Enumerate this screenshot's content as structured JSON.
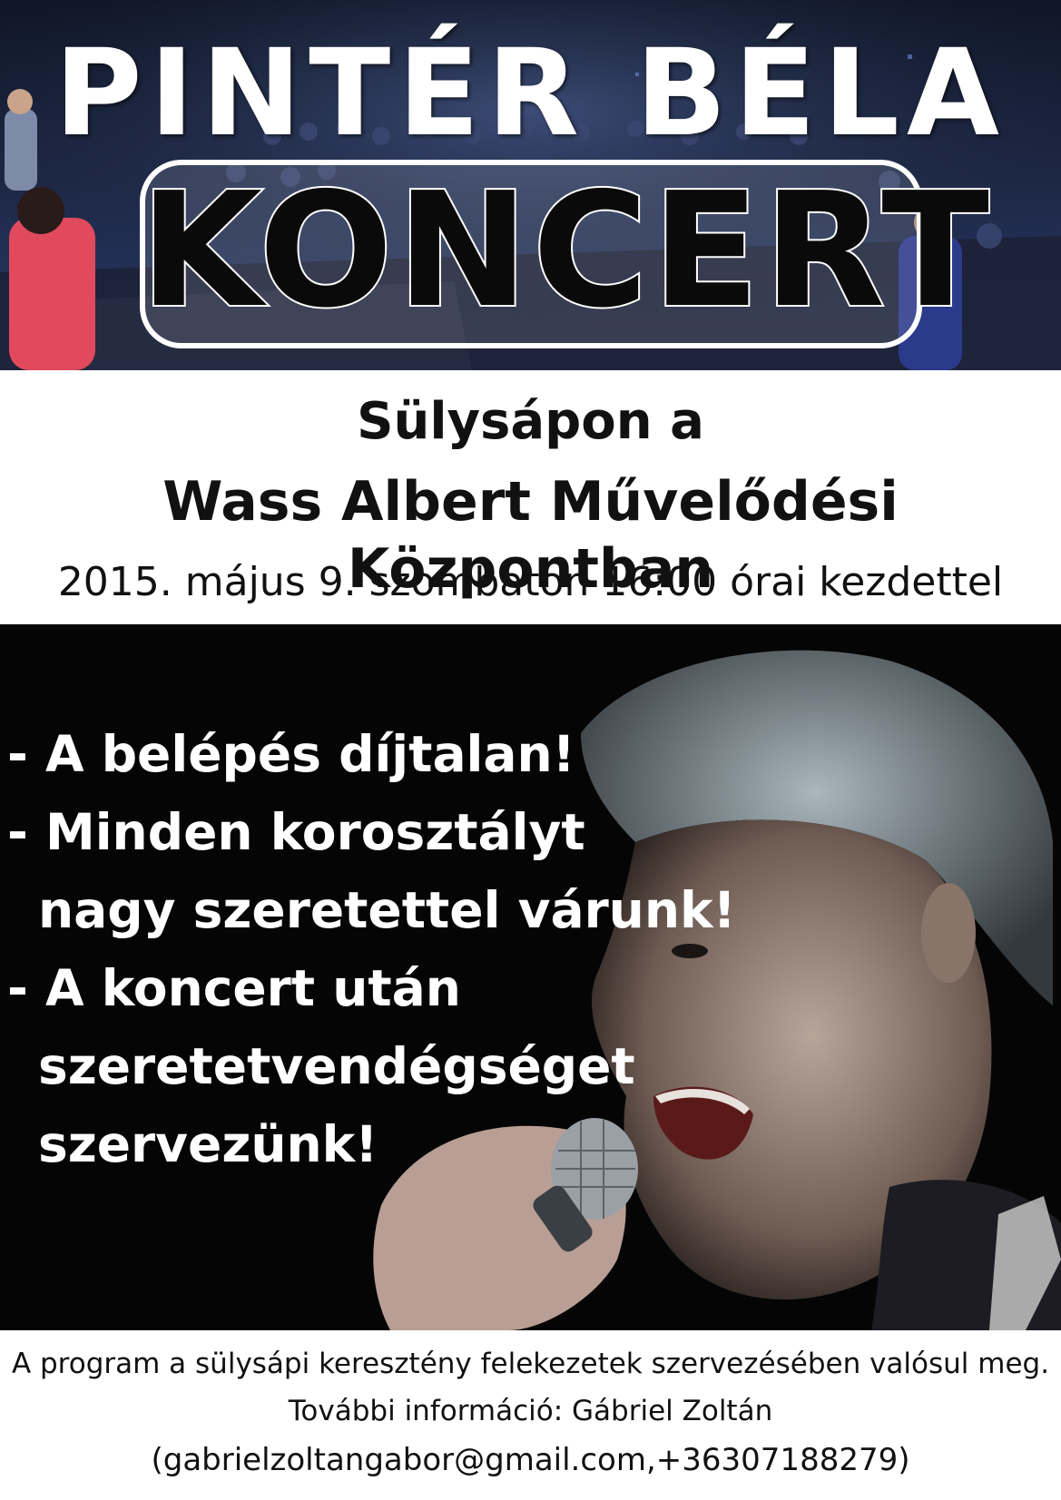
{
  "header": {
    "title": "PINTÉR BÉLA",
    "subtitle": "KONCERT"
  },
  "venue": {
    "line1": "Sülysápon a",
    "line2": "Wass Albert Művelődési Központban",
    "datetime": "2015. május 9. szombaton 16:00 órai kezdettel"
  },
  "bullets": {
    "b1": "- A belépés díjtalan!",
    "b2": "- Minden korosztályt",
    "b2_cont": "nagy szeretettel várunk!",
    "b3": "- A koncert után",
    "b3_cont1": "szeretetvendégséget",
    "b3_cont2": "szervezünk!"
  },
  "footer": {
    "organizer": "A program a sülysápi keresztény felekezetek szervezésében valósul meg.",
    "info": "További információ: Gábriel Zoltán",
    "contact": "(gabrielzoltangabor@gmail.com,+36307188279)"
  },
  "colors": {
    "hero_dark": "#1b2540",
    "panel_bg": "#050505",
    "text_dark": "#111111",
    "text_light": "#ffffff"
  }
}
